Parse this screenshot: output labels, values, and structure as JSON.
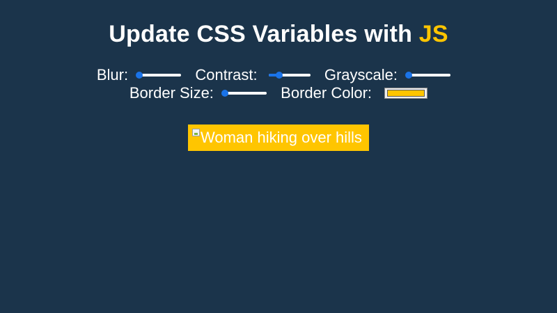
{
  "heading": {
    "text": "Update CSS Variables with ",
    "highlight": "JS",
    "highlight_color": "#ffc500"
  },
  "controls": {
    "blur": {
      "label": "Blur:",
      "value_fraction": 0.0
    },
    "contrast": {
      "label": "Contrast:",
      "value_fraction": 0.25
    },
    "grayscale": {
      "label": "Grayscale:",
      "value_fraction": 0.0
    },
    "border_size": {
      "label": "Border Size:",
      "value_fraction": 0.0
    },
    "border_color": {
      "label": "Border Color:",
      "value": "#ffc500"
    }
  },
  "image": {
    "alt": "Woman hiking over hills",
    "border_color": "#ffc500"
  },
  "colors": {
    "background": "#1b344b",
    "text": "#ffffff",
    "slider_accent": "#1a73e8"
  }
}
